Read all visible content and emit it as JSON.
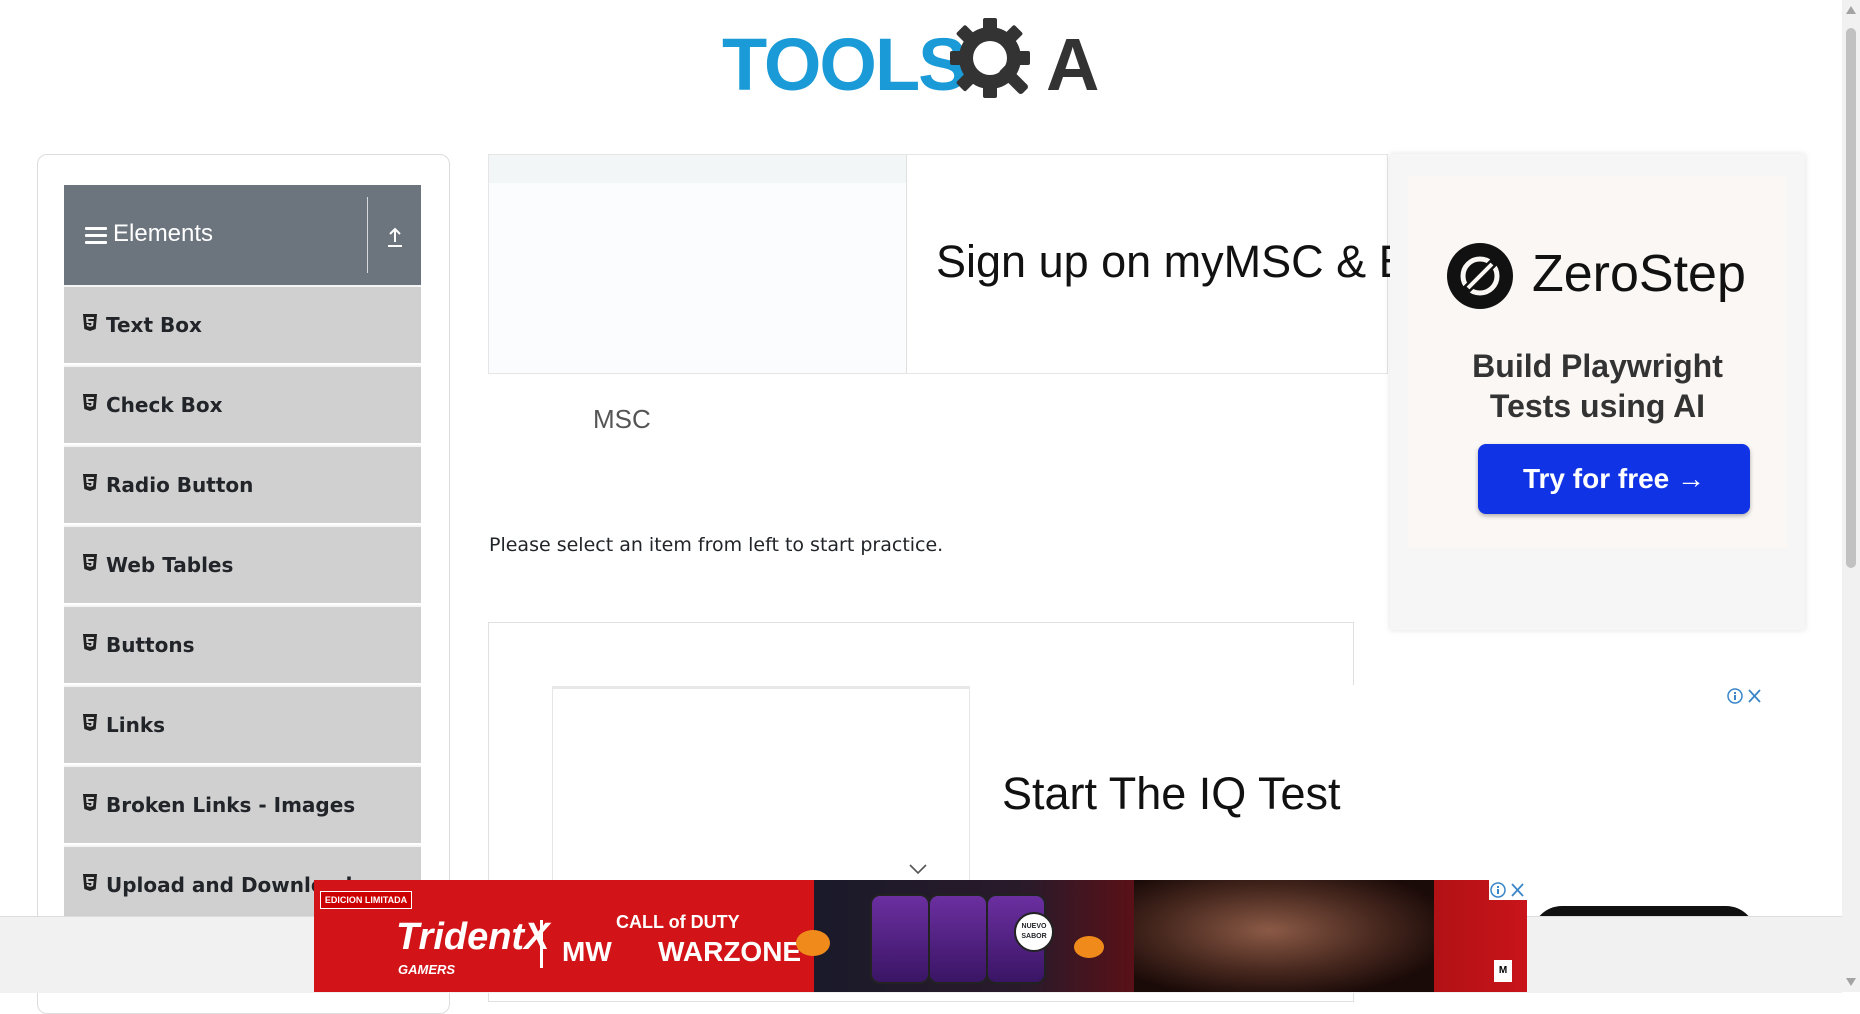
{
  "header": {
    "logo_text_left": "TOOLS",
    "logo_text_right": "A"
  },
  "sidebar": {
    "group_title": "Elements",
    "items": [
      {
        "label": "Text Box"
      },
      {
        "label": "Check Box"
      },
      {
        "label": "Radio Button"
      },
      {
        "label": "Web Tables"
      },
      {
        "label": "Buttons"
      },
      {
        "label": "Links"
      },
      {
        "label": "Broken Links - Images"
      },
      {
        "label": "Upload and Download"
      }
    ]
  },
  "main": {
    "instruction": "Please select an item from left to start practice."
  },
  "ads": {
    "top": {
      "headline": "Sign up on myMSC & B",
      "brand": "MSC"
    },
    "zerostep": {
      "brand": "ZeroStep",
      "tagline_line1": "Build Playwright",
      "tagline_line2": "Tests using AI",
      "cta": "Try for free →"
    },
    "iq": {
      "headline": "Start The IQ Test"
    },
    "banner": {
      "limited_label": "EDICION LIMITADA",
      "brand": "TridentX",
      "brand_sub": "GAMERS",
      "cod_top": "CALL of DUTY",
      "cod_mw": "MW",
      "cod_wz": "WARZONE",
      "badge": "NUEVO SABOR",
      "rating": "M"
    }
  },
  "colors": {
    "logo_blue": "#1a9bd7",
    "logo_dark": "#333333",
    "sidebar_header": "#6c757d",
    "sidebar_item": "#d0d0d0",
    "zerostep_button": "#1133e6",
    "banner_red": "#d21317"
  }
}
